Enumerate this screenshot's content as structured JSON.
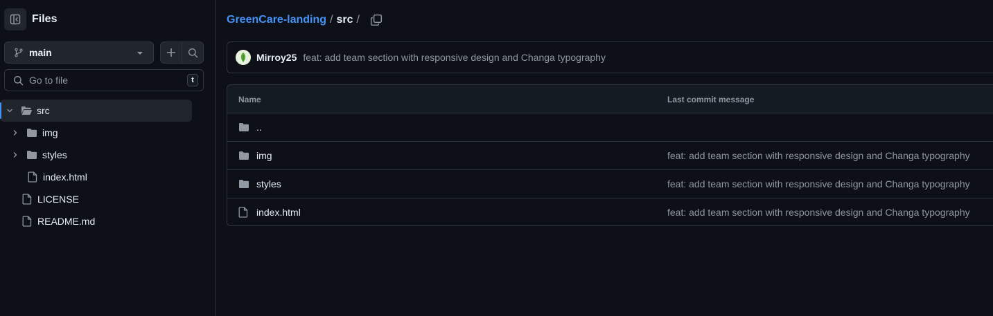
{
  "sidebar": {
    "title": "Files",
    "branch": "main",
    "search": {
      "placeholder": "Go to file",
      "shortcut": "t"
    },
    "tree": [
      {
        "name": "src",
        "kind": "folder-open",
        "depth": 0,
        "expanded": true,
        "selected": true
      },
      {
        "name": "img",
        "kind": "folder",
        "depth": 1,
        "expanded": false
      },
      {
        "name": "styles",
        "kind": "folder",
        "depth": 1,
        "expanded": false
      },
      {
        "name": "index.html",
        "kind": "file",
        "depth": 1
      },
      {
        "name": "LICENSE",
        "kind": "file",
        "depth": 0
      },
      {
        "name": "README.md",
        "kind": "file",
        "depth": 0
      }
    ]
  },
  "breadcrumb": {
    "repo": "GreenCare-landing",
    "current": "src",
    "separator": "/"
  },
  "latest_commit": {
    "author": "Mirroy25",
    "message": "feat: add team section with responsive design and Changa typography"
  },
  "table": {
    "headers": {
      "name": "Name",
      "message": "Last commit message"
    },
    "rows": [
      {
        "name": "..",
        "kind": "folder",
        "message": ""
      },
      {
        "name": "img",
        "kind": "folder",
        "message": "feat: add team section with responsive design and Changa typography"
      },
      {
        "name": "styles",
        "kind": "folder",
        "message": "feat: add team section with responsive design and Changa typography"
      },
      {
        "name": "index.html",
        "kind": "file",
        "message": "feat: add team section with responsive design and Changa typography"
      }
    ]
  },
  "colors": {
    "background": "#0d1117",
    "border": "#30363d",
    "link": "#4493f8",
    "muted": "#9198a1",
    "folder": "#9198a1"
  }
}
